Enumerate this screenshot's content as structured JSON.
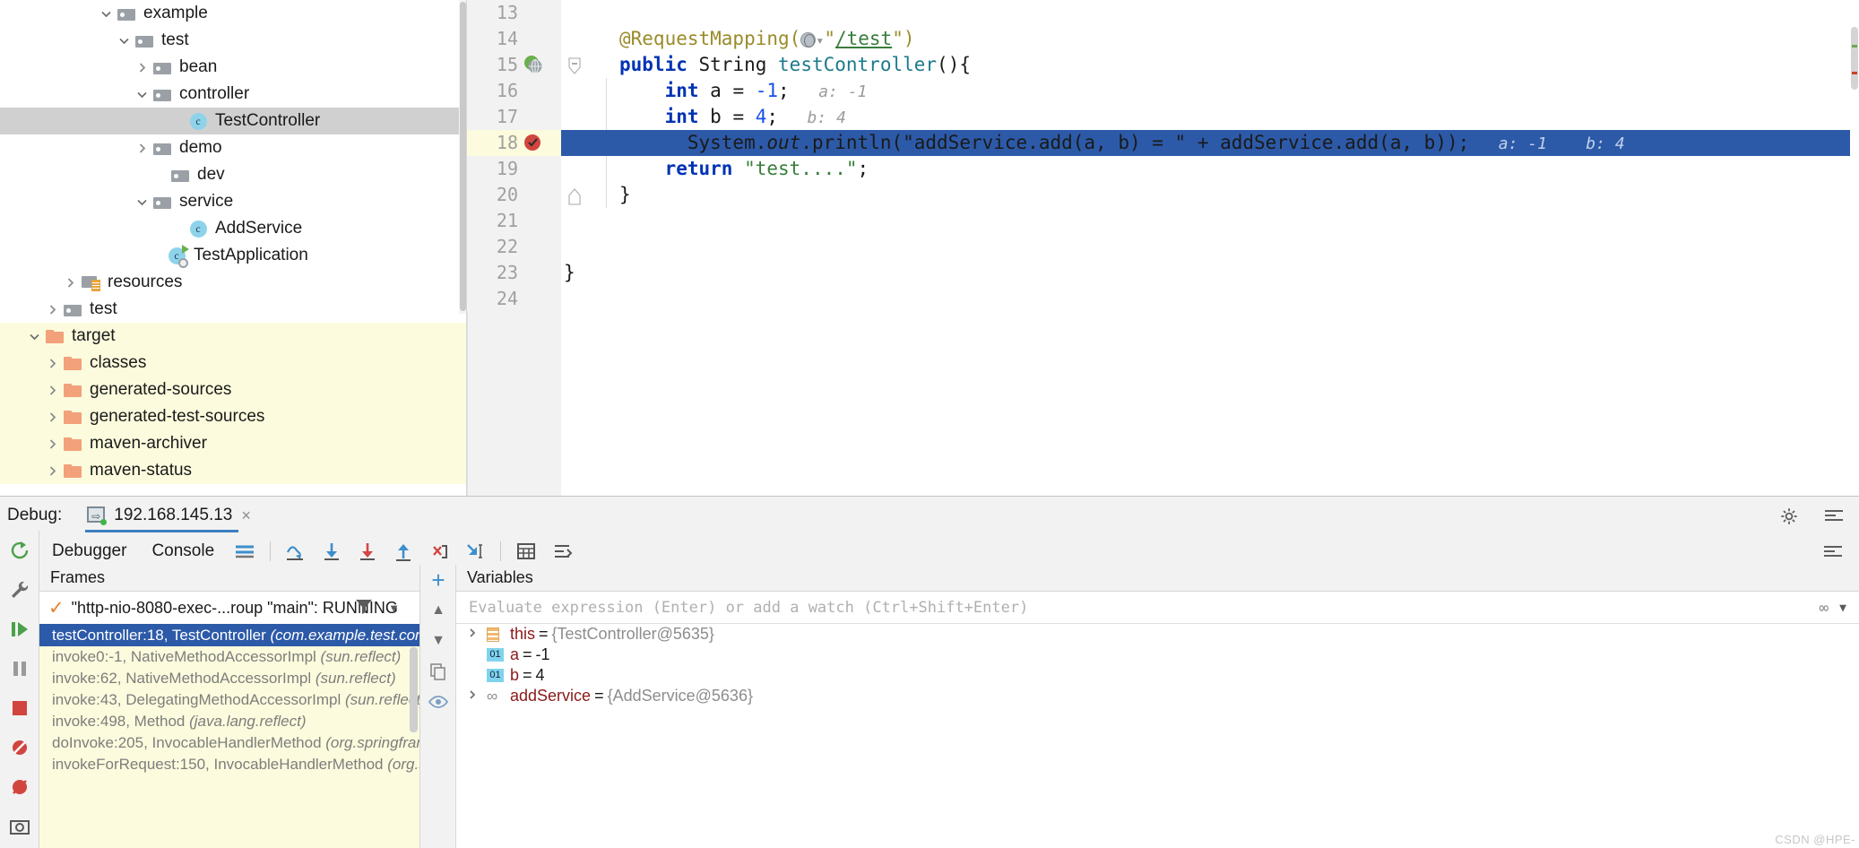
{
  "project": {
    "items": [
      {
        "twisty": "down",
        "icon": "folder-gray",
        "label": "example",
        "indent": 108,
        "state": "normal"
      },
      {
        "twisty": "down",
        "icon": "folder-gray",
        "label": "test",
        "indent": 128,
        "state": "normal"
      },
      {
        "twisty": "right",
        "icon": "folder-gray",
        "label": "bean",
        "indent": 148,
        "state": "normal"
      },
      {
        "twisty": "down",
        "icon": "folder-gray",
        "label": "controller",
        "indent": 148,
        "state": "normal"
      },
      {
        "twisty": "none",
        "icon": "class",
        "label": "TestController",
        "indent": 188,
        "state": "selected"
      },
      {
        "twisty": "right",
        "icon": "folder-gray",
        "label": "demo",
        "indent": 148,
        "state": "normal"
      },
      {
        "twisty": "none",
        "icon": "folder-gray",
        "label": "dev",
        "indent": 168,
        "state": "normal"
      },
      {
        "twisty": "down",
        "icon": "folder-gray",
        "label": "service",
        "indent": 148,
        "state": "normal"
      },
      {
        "twisty": "none",
        "icon": "class",
        "label": "AddService",
        "indent": 188,
        "state": "normal"
      },
      {
        "twisty": "none",
        "icon": "class-app",
        "label": "TestApplication",
        "indent": 164,
        "state": "normal"
      },
      {
        "twisty": "right",
        "icon": "folder-res",
        "label": "resources",
        "indent": 68,
        "state": "normal"
      },
      {
        "twisty": "right",
        "icon": "folder-gray",
        "label": "test",
        "indent": 48,
        "state": "normal"
      },
      {
        "twisty": "down",
        "icon": "folder-orange",
        "label": "target",
        "indent": 28,
        "state": "target"
      },
      {
        "twisty": "right",
        "icon": "folder-orange",
        "label": "classes",
        "indent": 48,
        "state": "target"
      },
      {
        "twisty": "right",
        "icon": "folder-orange",
        "label": "generated-sources",
        "indent": 48,
        "state": "target"
      },
      {
        "twisty": "right",
        "icon": "folder-orange",
        "label": "generated-test-sources",
        "indent": 48,
        "state": "target"
      },
      {
        "twisty": "right",
        "icon": "folder-orange",
        "label": "maven-archiver",
        "indent": 48,
        "state": "target"
      },
      {
        "twisty": "right",
        "icon": "folder-orange",
        "label": "maven-status",
        "indent": 48,
        "state": "target"
      }
    ]
  },
  "editor": {
    "lines": [
      {
        "num": "13",
        "gutter": "",
        "fold": "",
        "highlight": false,
        "segments": []
      },
      {
        "num": "14",
        "gutter": "",
        "fold": "",
        "highlight": false,
        "segments": [
          {
            "cls": "t-ann",
            "text": "@RequestMapping("
          },
          {
            "cls": "icon-globe",
            "text": ""
          },
          {
            "cls": "t-ann",
            "text": "\""
          },
          {
            "cls": "t-str t-underline",
            "text": "/test"
          },
          {
            "cls": "t-ann",
            "text": "\")"
          }
        ]
      },
      {
        "num": "15",
        "gutter": "web-globe",
        "fold": "collapse",
        "highlight": false,
        "segments": [
          {
            "cls": "t-kw",
            "text": "public "
          },
          {
            "cls": "t-type",
            "text": "String "
          },
          {
            "cls": "t-meth",
            "text": "testController"
          },
          {
            "cls": "t-plain",
            "text": "(){"
          }
        ]
      },
      {
        "num": "16",
        "gutter": "",
        "fold": "",
        "highlight": false,
        "segments": [
          {
            "cls": "t-plain",
            "text": "    "
          },
          {
            "cls": "t-kw",
            "text": "int"
          },
          {
            "cls": "t-plain",
            "text": " a = "
          },
          {
            "cls": "t-num",
            "text": "-1"
          },
          {
            "cls": "t-plain",
            "text": ";"
          },
          {
            "cls": "t-hint",
            "text": "   a: -1"
          }
        ]
      },
      {
        "num": "17",
        "gutter": "",
        "fold": "",
        "highlight": false,
        "segments": [
          {
            "cls": "t-plain",
            "text": "    "
          },
          {
            "cls": "t-kw",
            "text": "int"
          },
          {
            "cls": "t-plain",
            "text": " b = "
          },
          {
            "cls": "t-num",
            "text": "4"
          },
          {
            "cls": "t-plain",
            "text": ";"
          },
          {
            "cls": "t-hint",
            "text": "   b: 4"
          }
        ]
      },
      {
        "num": "18",
        "gutter": "breakpoint-hit",
        "fold": "",
        "highlight": true,
        "segments": [
          {
            "cls": "t-plain",
            "text": "      System."
          },
          {
            "cls": "t-ital",
            "text": "out"
          },
          {
            "cls": "t-plain",
            "text": ".println(\"addService.add(a, b) = \" + addService.add(a, b));"
          },
          {
            "cls": "t-hint-hl",
            "text": "   a: -1    b: 4"
          }
        ]
      },
      {
        "num": "19",
        "gutter": "",
        "fold": "",
        "highlight": false,
        "segments": [
          {
            "cls": "t-plain",
            "text": "    "
          },
          {
            "cls": "t-kw",
            "text": "return"
          },
          {
            "cls": "t-plain",
            "text": " "
          },
          {
            "cls": "t-str",
            "text": "\"test....\""
          },
          {
            "cls": "t-plain",
            "text": ";"
          }
        ]
      },
      {
        "num": "20",
        "gutter": "",
        "fold": "end",
        "highlight": false,
        "segments": [
          {
            "cls": "t-plain",
            "text": "}"
          }
        ]
      },
      {
        "num": "21",
        "gutter": "",
        "fold": "",
        "highlight": false,
        "segments": []
      },
      {
        "num": "22",
        "gutter": "",
        "fold": "",
        "highlight": false,
        "segments": []
      },
      {
        "num": "23",
        "gutter": "",
        "fold": "",
        "highlight": false,
        "segments": [
          {
            "cls": "t-plain",
            "text": "}"
          }
        ],
        "outdent": true
      },
      {
        "num": "24",
        "gutter": "",
        "fold": "",
        "highlight": false,
        "segments": []
      }
    ]
  },
  "debug": {
    "title_label": "Debug:",
    "session_tab": "192.168.145.13",
    "close_symbol": "×",
    "tabs": [
      {
        "label": "Debugger",
        "active": true
      },
      {
        "label": "Console",
        "active": false
      }
    ],
    "toolbar_icons": [
      "layout-icon",
      "step-over-icon",
      "step-into-icon",
      "force-step-into-icon",
      "step-out-icon",
      "drop-frame-icon",
      "run-to-cursor-icon",
      "evaluate-expression-icon",
      "settings-mute-icon"
    ],
    "rail_icons": [
      "rerun-icon",
      "wrench-icon",
      "resume-icon",
      "pause-icon",
      "stop-icon",
      "mute-breakpoints-icon",
      "view-breakpoints-icon",
      "camera-icon"
    ],
    "frames": {
      "header": "Frames",
      "thread": "\"http-nio-8080-exec-...roup \"main\": RUNNING",
      "rows": [
        {
          "text": "testController:18, TestController ",
          "pkg": "(com.example.test.controller)",
          "selected": true
        },
        {
          "text": "invoke0:-1, NativeMethodAccessorImpl ",
          "pkg": "(sun.reflect)",
          "selected": false
        },
        {
          "text": "invoke:62, NativeMethodAccessorImpl ",
          "pkg": "(sun.reflect)",
          "selected": false
        },
        {
          "text": "invoke:43, DelegatingMethodAccessorImpl ",
          "pkg": "(sun.reflect)",
          "selected": false
        },
        {
          "text": "invoke:498, Method ",
          "pkg": "(java.lang.reflect)",
          "selected": false
        },
        {
          "text": "doInvoke:205, InvocableHandlerMethod ",
          "pkg": "(org.springframewo",
          "selected": false
        },
        {
          "text": "invokeForRequest:150, InvocableHandlerMethod ",
          "pkg": "(org.spring",
          "selected": false
        }
      ]
    },
    "variables": {
      "header": "Variables",
      "eval_placeholder": "Evaluate expression (Enter) or add a watch (Ctrl+Shift+Enter)",
      "rows": [
        {
          "twisty": "right",
          "icon": "fields",
          "name": "this",
          "eq": "=",
          "value": "{TestController@5635}",
          "value_kind": "ref"
        },
        {
          "twisty": "none",
          "icon": "prim",
          "icon_label": "01",
          "name": "a",
          "eq": "=",
          "value": "-1",
          "value_kind": "num"
        },
        {
          "twisty": "none",
          "icon": "prim",
          "icon_label": "01",
          "name": "b",
          "eq": "=",
          "value": "4",
          "value_kind": "num"
        },
        {
          "twisty": "right",
          "icon": "obj",
          "name": "addService",
          "eq": "=",
          "value": "{AddService@5636}",
          "value_kind": "ref"
        }
      ]
    }
  },
  "watermark": "CSDN @HPE-"
}
